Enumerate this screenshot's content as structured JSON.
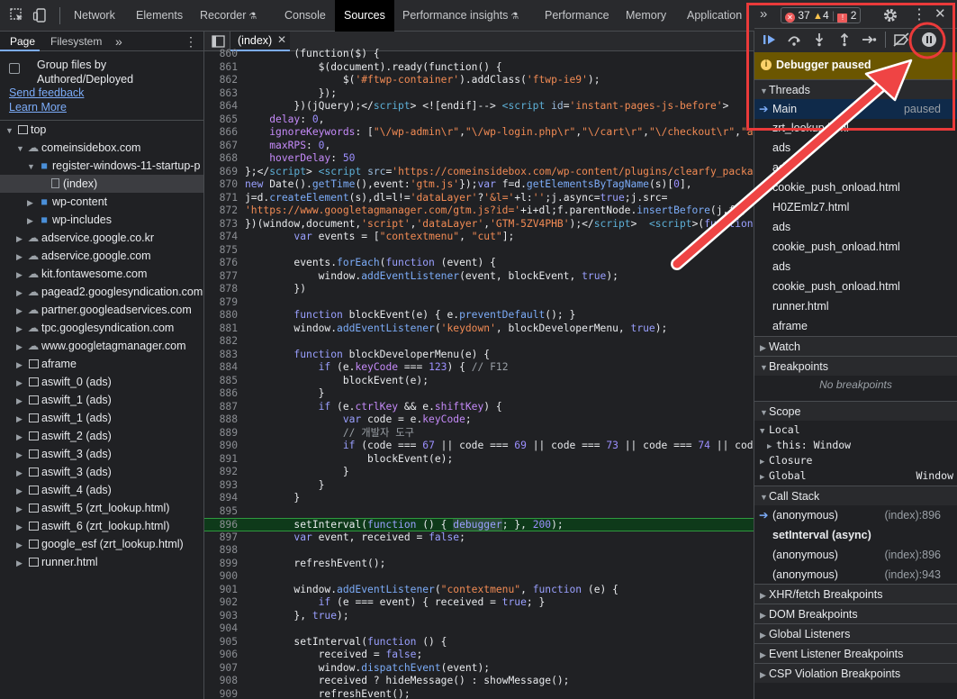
{
  "topbar": {
    "tabs": [
      "Network",
      "Elements",
      "Recorder",
      "Console",
      "Sources",
      "Performance insights",
      "Performance",
      "Memory",
      "Application"
    ],
    "active_tab": "Sources",
    "errors_count": "37",
    "warnings_count": "4",
    "issues_count": "2"
  },
  "navigator": {
    "tabs": [
      "Page",
      "Filesystem"
    ],
    "group_files_label": "Group files by Authored/Deployed",
    "send_feedback": "Send feedback",
    "learn_more": "Learn More",
    "tree": [
      {
        "label": "top",
        "type": "frame",
        "indent": 0,
        "open": true
      },
      {
        "label": "comeinsidebox.com",
        "type": "cloud",
        "indent": 1,
        "open": true
      },
      {
        "label": "register-windows-11-startup-p",
        "type": "folder",
        "indent": 2,
        "open": true
      },
      {
        "label": "(index)",
        "type": "file",
        "indent": 3,
        "selected": true
      },
      {
        "label": "wp-content",
        "type": "folder",
        "indent": 2,
        "open": false
      },
      {
        "label": "wp-includes",
        "type": "folder",
        "indent": 2,
        "open": false
      },
      {
        "label": "adservice.google.co.kr",
        "type": "cloud",
        "indent": 1,
        "open": false
      },
      {
        "label": "adservice.google.com",
        "type": "cloud",
        "indent": 1,
        "open": false
      },
      {
        "label": "kit.fontawesome.com",
        "type": "cloud",
        "indent": 1,
        "open": false
      },
      {
        "label": "pagead2.googlesyndication.com",
        "type": "cloud",
        "indent": 1,
        "open": false
      },
      {
        "label": "partner.googleadservices.com",
        "type": "cloud",
        "indent": 1,
        "open": false
      },
      {
        "label": "tpc.googlesyndication.com",
        "type": "cloud",
        "indent": 1,
        "open": false
      },
      {
        "label": "www.googletagmanager.com",
        "type": "cloud",
        "indent": 1,
        "open": false
      },
      {
        "label": "aframe",
        "type": "frame",
        "indent": 1,
        "open": false
      },
      {
        "label": "aswift_0 (ads)",
        "type": "frame",
        "indent": 1,
        "open": false
      },
      {
        "label": "aswift_1 (ads)",
        "type": "frame",
        "indent": 1,
        "open": false
      },
      {
        "label": "aswift_1 (ads)",
        "type": "frame",
        "indent": 1,
        "open": false
      },
      {
        "label": "aswift_2 (ads)",
        "type": "frame",
        "indent": 1,
        "open": false
      },
      {
        "label": "aswift_3 (ads)",
        "type": "frame",
        "indent": 1,
        "open": false
      },
      {
        "label": "aswift_3 (ads)",
        "type": "frame",
        "indent": 1,
        "open": false
      },
      {
        "label": "aswift_4 (ads)",
        "type": "frame",
        "indent": 1,
        "open": false
      },
      {
        "label": "aswift_5 (zrt_lookup.html)",
        "type": "frame",
        "indent": 1,
        "open": false
      },
      {
        "label": "aswift_6 (zrt_lookup.html)",
        "type": "frame",
        "indent": 1,
        "open": false
      },
      {
        "label": "google_esf (zrt_lookup.html)",
        "type": "frame",
        "indent": 1,
        "open": false
      },
      {
        "label": "runner.html",
        "type": "frame",
        "indent": 1,
        "open": false
      }
    ]
  },
  "editor": {
    "tab_label": "(index)",
    "highlight_line": "896",
    "lines": [
      {
        "n": "860",
        "h": "        <span class='ident'>(function($) {</span>"
      },
      {
        "n": "861",
        "h": "            $(document).ready(function() {"
      },
      {
        "n": "862",
        "h": "                $(<span class='s'>'#ftwp-container'</span>).addClass(<span class='s'>'ftwp-ie9'</span>);"
      },
      {
        "n": "863",
        "h": "            });"
      },
      {
        "n": "864",
        "h": "        })(jQuery);&lt;/<span class='tag'>script</span>&gt; &lt;![endif]--&gt; <span class='tag'>&lt;script</span> <span class='attr'>id</span>=<span class='s'>'instant-pages-js-before'</span>&gt;"
      },
      {
        "n": "865",
        "h": "    <span class='prop'>delay</span>: <span class='n'>0</span>,"
      },
      {
        "n": "866",
        "h": "    <span class='prop'>ignoreKeywords</span>: [<span class='s'>\"\\/wp-admin\\r\"</span>,<span class='s'>\"\\/wp-login.php\\r\"</span>,<span class='s'>\"\\/cart\\r\"</span>,<span class='s'>\"\\/checkout\\r\"</span>,<span class='s'>\"a</span>"
      },
      {
        "n": "867",
        "h": "    <span class='prop'>maxRPS</span>: <span class='n'>0</span>,"
      },
      {
        "n": "868",
        "h": "    <span class='prop'>hoverDelay</span>: <span class='n'>50</span>"
      },
      {
        "n": "869",
        "h": "};&lt;/<span class='tag'>script</span>&gt; <span class='tag'>&lt;script</span> <span class='attr'>src</span>=<span class='s'>'https://comeinsidebox.com/wp-content/plugins/clearfy_packa</span>"
      },
      {
        "n": "870",
        "h": "<span class='k'>new</span> Date().<span class='p'>getTime</span>(),event:<span class='s'>'gtm.js'</span>});<span class='k'>var</span> f=d.<span class='p'>getElementsByTagName</span>(s)[<span class='n'>0</span>],"
      },
      {
        "n": "871",
        "h": "j=d.<span class='p'>createElement</span>(s),dl=l!=<span class='s'>'dataLayer'</span>?<span class='s'>'&amp;l='</span>+l:<span class='s'>''</span>;j.async=<span class='k'>true</span>;j.src="
      },
      {
        "n": "872",
        "h": "<span class='s'>'https://www.googletagmanager.com/gtm.js?id='</span>+i+dl;f.parentNode.<span class='p'>insertBefore</span>(j,f);"
      },
      {
        "n": "873",
        "h": "})(window,document,<span class='s'>'script'</span>,<span class='s'>'dataLayer'</span>,<span class='s'>'GTM-5ZV4PHB'</span>);&lt;/<span class='tag'>script</span>&gt;  <span class='tag'>&lt;script</span>&gt;(<span class='k'>function</span>"
      },
      {
        "n": "874",
        "h": "        <span class='k'>var</span> events = [<span class='s'>\"contextmenu\"</span>, <span class='s'>\"cut\"</span>];"
      },
      {
        "n": "875",
        "h": ""
      },
      {
        "n": "876",
        "h": "        events.<span class='p'>forEach</span>(<span class='k'>function</span> (event) {"
      },
      {
        "n": "877",
        "h": "            window.<span class='p'>addEventListener</span>(event, blockEvent, <span class='k'>true</span>);"
      },
      {
        "n": "878",
        "h": "        })"
      },
      {
        "n": "879",
        "h": ""
      },
      {
        "n": "880",
        "h": "        <span class='k'>function</span> blockEvent(e) { e.<span class='p'>preventDefault</span>(); }"
      },
      {
        "n": "881",
        "h": "        window.<span class='p'>addEventListener</span>(<span class='s'>'keydown'</span>, blockDeveloperMenu, <span class='k'>true</span>);"
      },
      {
        "n": "882",
        "h": ""
      },
      {
        "n": "883",
        "h": "        <span class='k'>function</span> blockDeveloperMenu(e) {"
      },
      {
        "n": "884",
        "h": "            <span class='k'>if</span> (e.<span class='prop'>keyCode</span> === <span class='n'>123</span>) { <span class='c'>// F12</span>"
      },
      {
        "n": "885",
        "h": "                blockEvent(e);"
      },
      {
        "n": "886",
        "h": "            }"
      },
      {
        "n": "887",
        "h": "            <span class='k'>if</span> (e.<span class='prop'>ctrlKey</span> &amp;&amp; e.<span class='prop'>shiftKey</span>) {"
      },
      {
        "n": "888",
        "h": "                <span class='k'>var</span> code = e.<span class='prop'>keyCode</span>;"
      },
      {
        "n": "889",
        "h": "                <span class='c'>// 개발자 도구</span>"
      },
      {
        "n": "890",
        "h": "                <span class='k'>if</span> (code === <span class='n'>67</span> || code === <span class='n'>69</span> || code === <span class='n'>73</span> || code === <span class='n'>74</span> || cod"
      },
      {
        "n": "891",
        "h": "                    blockEvent(e);"
      },
      {
        "n": "892",
        "h": "                }"
      },
      {
        "n": "893",
        "h": "            }"
      },
      {
        "n": "894",
        "h": "        }"
      },
      {
        "n": "895",
        "h": ""
      },
      {
        "n": "896",
        "h": "        setInterval(<span class='k'>function</span> () { <span class='k' style='background:#2a4a36'>debugger</span>; }, <span class='n'>200</span>);"
      },
      {
        "n": "897",
        "h": "        <span class='k'>var</span> event, received = <span class='k'>false</span>;"
      },
      {
        "n": "898",
        "h": ""
      },
      {
        "n": "899",
        "h": "        refreshEvent();"
      },
      {
        "n": "900",
        "h": ""
      },
      {
        "n": "901",
        "h": "        window.<span class='p'>addEventListener</span>(<span class='s'>\"contextmenu\"</span>, <span class='k'>function</span> (e) {"
      },
      {
        "n": "902",
        "h": "            <span class='k'>if</span> (e === event) { received = <span class='k'>true</span>; }"
      },
      {
        "n": "903",
        "h": "        }, <span class='k'>true</span>);"
      },
      {
        "n": "904",
        "h": ""
      },
      {
        "n": "905",
        "h": "        setInterval(<span class='k'>function</span> () {"
      },
      {
        "n": "906",
        "h": "            received = <span class='k'>false</span>;"
      },
      {
        "n": "907",
        "h": "            window.<span class='p'>dispatchEvent</span>(event);"
      },
      {
        "n": "908",
        "h": "            received ? hideMessage() : showMessage();"
      },
      {
        "n": "909",
        "h": "            refreshEvent();"
      }
    ]
  },
  "debugger": {
    "paused_banner": "Debugger paused",
    "threads_title": "Threads",
    "main_thread": "Main",
    "main_status": "paused",
    "threads": [
      "zrt_lookup.html",
      "ads",
      "ads",
      "cookie_push_onload.html",
      "H0ZEmlz7.html",
      "ads",
      "cookie_push_onload.html",
      "ads",
      "cookie_push_onload.html",
      "runner.html",
      "aframe"
    ],
    "watch_title": "Watch",
    "breakpoints_title": "Breakpoints",
    "no_breakpoints": "No breakpoints",
    "scope_title": "Scope",
    "scope_local": "Local",
    "scope_this_key": "this:",
    "scope_this_val": "Window",
    "scope_closure": "Closure",
    "scope_global": "Global",
    "scope_global_val": "Window",
    "call_stack_title": "Call Stack",
    "call_stack": [
      {
        "name": "(anonymous)",
        "loc": "(index):896",
        "current": true
      },
      {
        "name": "setInterval (async)",
        "loc": "",
        "async": true
      },
      {
        "name": "(anonymous)",
        "loc": "(index):896"
      },
      {
        "name": "(anonymous)",
        "loc": "(index):943"
      }
    ],
    "bottom_sections": [
      "XHR/fetch Breakpoints",
      "DOM Breakpoints",
      "Global Listeners",
      "Event Listener Breakpoints",
      "CSP Violation Breakpoints"
    ]
  }
}
